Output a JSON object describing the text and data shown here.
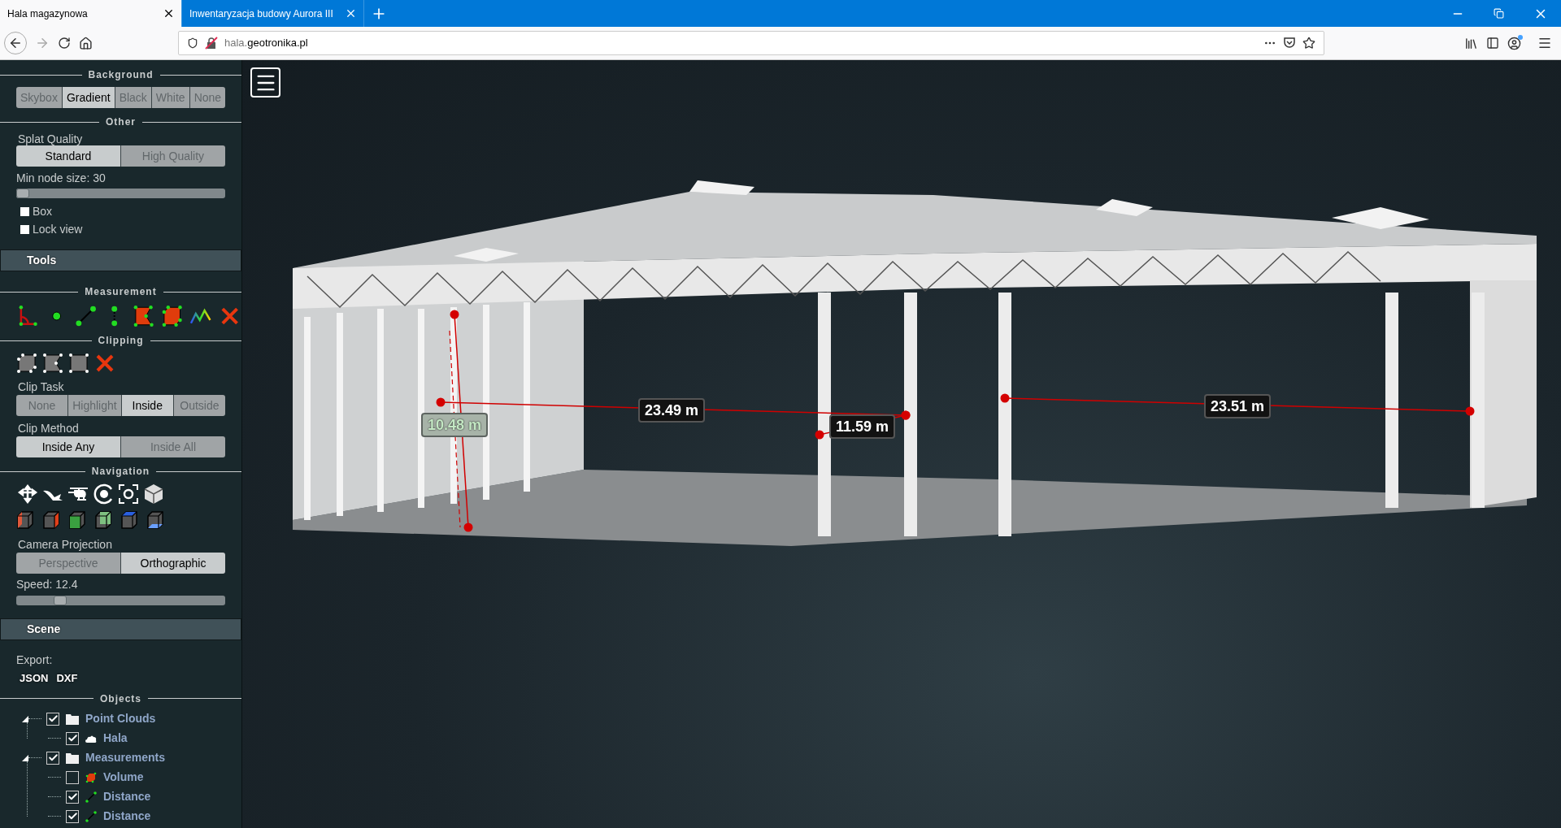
{
  "browser": {
    "tabs": [
      {
        "title": "Hala magazynowa",
        "selected": true
      },
      {
        "title": "Inwentaryzacja budowy Aurora III",
        "selected": false
      }
    ],
    "url_host": "hala.",
    "url_domain": "geotronika.pl"
  },
  "sidebar": {
    "background": {
      "title": "Background",
      "options": [
        {
          "label": "Skybox",
          "selected": false
        },
        {
          "label": "Gradient",
          "selected": true
        },
        {
          "label": "Black",
          "selected": false
        },
        {
          "label": "White",
          "selected": false
        },
        {
          "label": "None",
          "selected": false
        }
      ]
    },
    "other": {
      "title": "Other",
      "splat_label": "Splat Quality",
      "splat_options": [
        {
          "label": "Standard",
          "selected": true
        },
        {
          "label": "High Quality",
          "selected": false
        }
      ],
      "node_size_label": "Min node size: 30",
      "node_size": {
        "level": 0.0
      },
      "checkboxes": [
        {
          "label": "Box",
          "checked": false
        },
        {
          "label": "Lock view",
          "checked": false
        }
      ]
    },
    "tools_header": "Tools",
    "measurement_title": "Measurement",
    "clipping": {
      "title": "Clipping",
      "task_label": "Clip Task",
      "task_options": [
        {
          "label": "None",
          "selected": false
        },
        {
          "label": "Highlight",
          "selected": false
        },
        {
          "label": "Inside",
          "selected": true
        },
        {
          "label": "Outside",
          "selected": false
        }
      ],
      "method_label": "Clip Method",
      "method_options": [
        {
          "label": "Inside Any",
          "selected": true
        },
        {
          "label": "Inside All",
          "selected": false
        }
      ]
    },
    "navigation": {
      "title": "Navigation",
      "projection_label": "Camera Projection",
      "projection_options": [
        {
          "label": "Perspective",
          "selected": false
        },
        {
          "label": "Orthographic",
          "selected": true
        }
      ],
      "speed_label": "Speed: 12.4",
      "speed": {
        "level": 0.19
      }
    },
    "scene_header": "Scene",
    "export_label": "Export:",
    "export_buttons": [
      "JSON",
      "DXF"
    ],
    "objects_title": "Objects",
    "tree": [
      {
        "label": "Point Clouds",
        "kind": "folder",
        "checked": true,
        "expanded": true,
        "children": [
          {
            "label": "Hala",
            "kind": "cloud",
            "checked": true
          }
        ]
      },
      {
        "label": "Measurements",
        "kind": "folder",
        "checked": true,
        "expanded": true,
        "children": [
          {
            "label": "Volume",
            "kind": "volume",
            "checked": false
          },
          {
            "label": "Distance",
            "kind": "distance",
            "checked": true
          },
          {
            "label": "Distance",
            "kind": "distance",
            "checked": true
          }
        ]
      }
    ]
  },
  "measurements": [
    {
      "label": "10.48 m",
      "selected": true
    },
    {
      "label": "23.49 m",
      "selected": false
    },
    {
      "label": "11.59 m",
      "selected": false
    },
    {
      "label": "23.51 m",
      "selected": false
    }
  ]
}
